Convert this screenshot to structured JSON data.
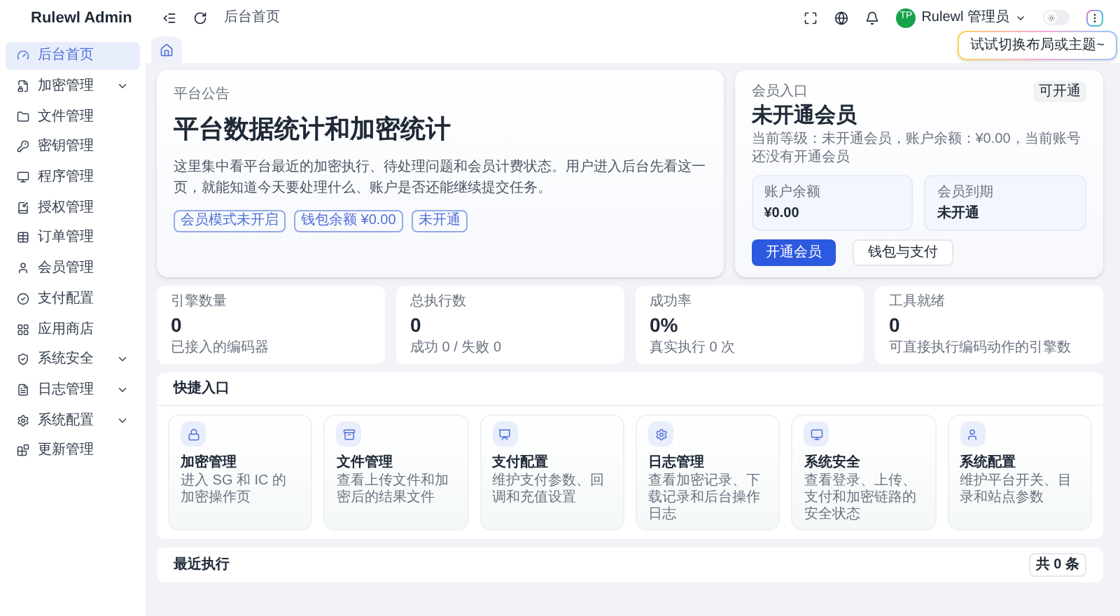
{
  "app": {
    "title": "Rulewl Admin"
  },
  "header": {
    "breadcrumb": "后台首页",
    "user": {
      "initials": "TP",
      "name": "Rulewl 管理员"
    },
    "theme_toggle": {
      "on": false
    },
    "tooltip": "试试切换布局或主题~"
  },
  "tabs": [
    {
      "kind": "home",
      "selected": true
    }
  ],
  "sidebar": {
    "items": [
      {
        "label": "后台首页",
        "selected": true,
        "expandable": false
      },
      {
        "label": "加密管理",
        "selected": false,
        "expandable": true
      },
      {
        "label": "文件管理",
        "selected": false,
        "expandable": false
      },
      {
        "label": "密钥管理",
        "selected": false,
        "expandable": false
      },
      {
        "label": "程序管理",
        "selected": false,
        "expandable": false
      },
      {
        "label": "授权管理",
        "selected": false,
        "expandable": false
      },
      {
        "label": "订单管理",
        "selected": false,
        "expandable": false
      },
      {
        "label": "会员管理",
        "selected": false,
        "expandable": false
      },
      {
        "label": "支付配置",
        "selected": false,
        "expandable": false
      },
      {
        "label": "应用商店",
        "selected": false,
        "expandable": false
      },
      {
        "label": "系统安全",
        "selected": false,
        "expandable": true
      },
      {
        "label": "日志管理",
        "selected": false,
        "expandable": true
      },
      {
        "label": "系统配置",
        "selected": false,
        "expandable": true
      },
      {
        "label": "更新管理",
        "selected": false,
        "expandable": false
      }
    ]
  },
  "hero": {
    "eyebrow": "平台公告",
    "title": "平台数据统计和加密统计",
    "description": "这里集中看平台最近的加密执行、待处理问题和会员计费状态。用户进入后台先看这一页，就能知道今天要处理什么、账户是否还能继续提交任务。",
    "tags": [
      "会员模式未开启",
      "钱包余额 ¥0.00",
      "未开通"
    ]
  },
  "membership": {
    "eyebrow": "会员入口",
    "badge": "可开通",
    "title": "未开通会员",
    "description": "当前等级：未开通会员，账户余额：¥0.00，当前账号还没有开通会员",
    "balance": {
      "label": "账户余额",
      "value": "¥0.00"
    },
    "expiry": {
      "label": "会员到期",
      "value": "未开通"
    },
    "buttons": [
      {
        "label": "开通会员",
        "kind": "primary"
      },
      {
        "label": "钱包与支付",
        "kind": "secondary"
      }
    ]
  },
  "stats": [
    {
      "label": "引擎数量",
      "value": "0",
      "note": "已接入的编码器"
    },
    {
      "label": "总执行数",
      "value": "0",
      "note": "成功 0 / 失败 0"
    },
    {
      "label": "成功率",
      "value": "0%",
      "note": "真实执行 0 次"
    },
    {
      "label": "工具就绪",
      "value": "0",
      "note": "可直接执行编码动作的引擎数"
    }
  ],
  "quick_entry": {
    "title": "快捷入口",
    "items": [
      {
        "title": "加密管理",
        "description": "进入 SG 和 IC 的加密操作页"
      },
      {
        "title": "文件管理",
        "description": "查看上传文件和加密后的结果文件"
      },
      {
        "title": "支付配置",
        "description": "维护支付参数、回调和充值设置"
      },
      {
        "title": "日志管理",
        "description": "查看加密记录、下载记录和后台操作日志"
      },
      {
        "title": "系统安全",
        "description": "查看登录、上传、支付和加密链路的安全状态"
      },
      {
        "title": "系统配置",
        "description": "维护平台开关、目录和站点参数"
      }
    ]
  },
  "recent": {
    "title": "最近执行",
    "count": "共 0 条"
  }
}
